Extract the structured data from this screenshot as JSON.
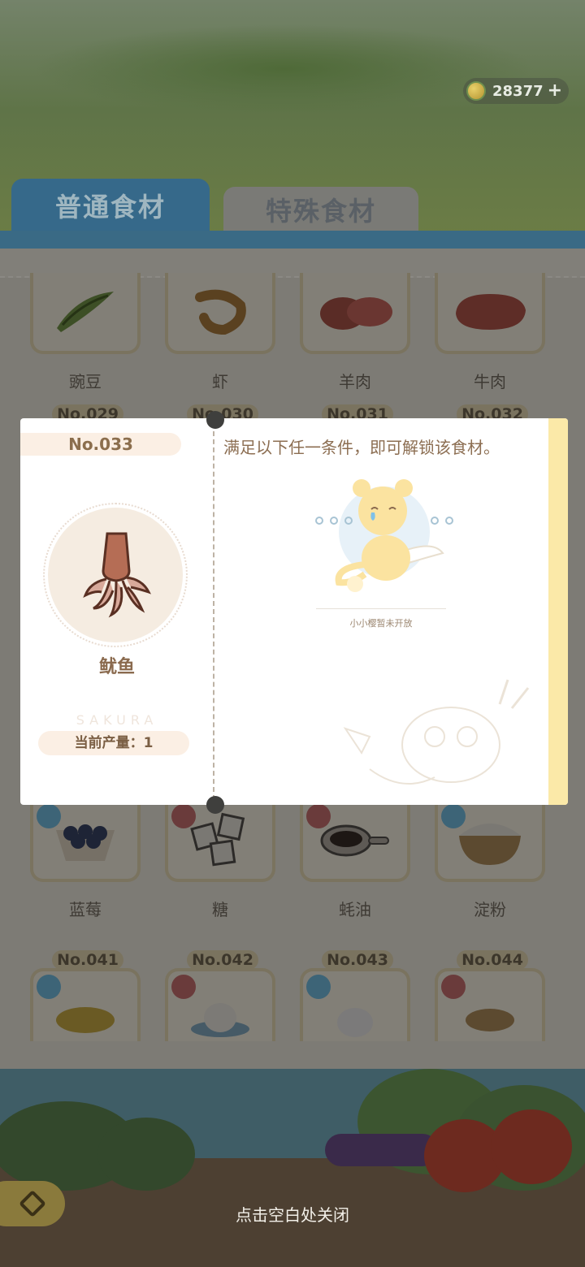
{
  "currency": {
    "amount": "28377",
    "plus": "+"
  },
  "tabs": [
    {
      "label": "普通食材",
      "active": true
    },
    {
      "label": "特殊食材",
      "active": false
    }
  ],
  "grid": {
    "row1": [
      {
        "name": "豌豆"
      },
      {
        "name": "虾"
      },
      {
        "name": "羊肉"
      },
      {
        "name": "牛肉"
      }
    ],
    "row2_numbers": [
      "No.029",
      "No.030",
      "No.031",
      "No.032"
    ],
    "row3": [
      {
        "name": "蓝莓"
      },
      {
        "name": "糖"
      },
      {
        "name": "蚝油"
      },
      {
        "name": "淀粉"
      }
    ],
    "row4_numbers": [
      "No.041",
      "No.042",
      "No.043",
      "No.044"
    ]
  },
  "modal": {
    "number": "No.033",
    "item_name": "鱿鱼",
    "brand": "SAKURA",
    "output": "当前产量：1",
    "condition_text": "满足以下任一条件，即可解锁该食材。",
    "mascot_caption": "小小樱暂未开放"
  },
  "footer": {
    "close_hint": "点击空白处关闭"
  },
  "colors": {
    "tab_active": "#36698a",
    "overlay": "#3f3f3d",
    "accent_text": "#8c6e52"
  }
}
